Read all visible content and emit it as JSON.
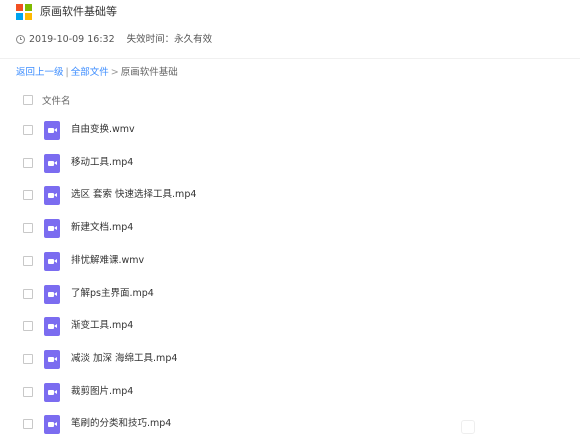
{
  "header": {
    "title": "原画软件基础等",
    "date": "2019-10-09 16:32",
    "expire_label": "失效时间：永久有效"
  },
  "breadcrumb": {
    "back": "返回上一级",
    "separator": "|",
    "all_files": "全部文件",
    "arrow": ">",
    "current": "原画软件基础"
  },
  "list": {
    "column_header": "文件名",
    "files": [
      {
        "name": "自由变换.wmv",
        "icon": "video-file-icon"
      },
      {
        "name": "移动工具.mp4",
        "icon": "video-file-icon"
      },
      {
        "name": "选区 套索 快速选择工具.mp4",
        "icon": "video-file-icon"
      },
      {
        "name": "新建文档.mp4",
        "icon": "video-file-icon"
      },
      {
        "name": "排忧解难课.wmv",
        "icon": "video-file-icon"
      },
      {
        "name": "了解ps主界面.mp4",
        "icon": "video-file-icon"
      },
      {
        "name": "渐变工具.mp4",
        "icon": "video-file-icon"
      },
      {
        "name": "减淡 加深 海绵工具.mp4",
        "icon": "video-file-icon"
      },
      {
        "name": "裁剪图片.mp4",
        "icon": "video-file-icon"
      },
      {
        "name": "笔刷的分类和技巧.mp4",
        "icon": "video-file-icon"
      }
    ]
  },
  "colors": {
    "accent_link": "#3b8cff",
    "video_icon": "#7b6cf0"
  }
}
